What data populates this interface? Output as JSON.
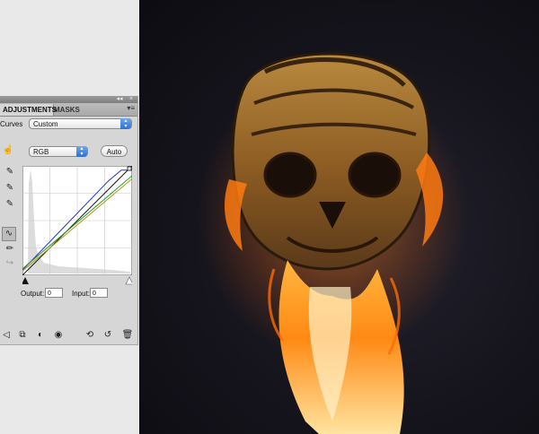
{
  "panel": {
    "tabs": [
      {
        "label": "ADJUSTMENTS"
      },
      {
        "label": "MASKS"
      }
    ],
    "menu_icon": "panel-menu-icon",
    "curves_label": "Curves",
    "preset_value": "Custom",
    "channel_value": "RGB",
    "auto_label": "Auto",
    "output_label": "Output:",
    "output_value": "0",
    "input_label": "Input:",
    "input_value": "0",
    "left_tools": [
      "hand-adjust-icon",
      "black-eyedropper-icon",
      "gray-eyedropper-icon",
      "white-eyedropper-icon",
      "curve-mode-icon",
      "pencil-mode-icon",
      "smooth-icon"
    ],
    "bottom_icons": [
      "return-icon",
      "clip-layer-icon",
      "layer-mask-icon",
      "visibility-eye-icon",
      "view-previous-icon",
      "reset-icon",
      "trash-icon"
    ]
  },
  "chart_data": {
    "type": "line",
    "title": "",
    "xlabel": "",
    "ylabel": "",
    "xlim": [
      0,
      255
    ],
    "ylim": [
      0,
      255
    ],
    "grid": true,
    "series": [
      {
        "color": "#1a1a1a",
        "x": [
          0,
          255
        ],
        "y": [
          0,
          255
        ]
      },
      {
        "color": "#1f2fd6",
        "x": [
          0,
          200,
          230,
          255
        ],
        "y": [
          12,
          220,
          245,
          245
        ]
      },
      {
        "color": "#2a9a2a",
        "x": [
          0,
          255
        ],
        "y": [
          15,
          232
        ]
      },
      {
        "color": "#b29a1a",
        "x": [
          0,
          255
        ],
        "y": [
          10,
          225
        ]
      }
    ]
  }
}
